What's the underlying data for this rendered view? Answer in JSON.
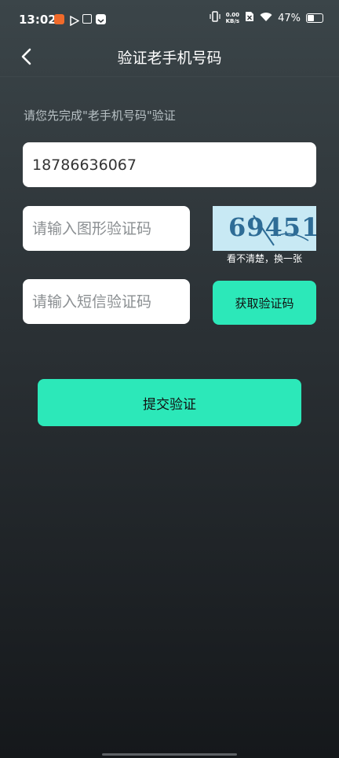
{
  "status_bar": {
    "time": "13:02",
    "net_speed_value": "0.00",
    "net_speed_unit": "KB/s",
    "battery": "47%"
  },
  "header": {
    "title": "验证老手机号码"
  },
  "form": {
    "hint": "请您先完成\"老手机号码\"验证",
    "phone_value": "18786636067",
    "captcha_placeholder": "请输入图形验证码",
    "captcha_image_text": "69451",
    "captcha_refresh_label": "看不清楚，换一张",
    "sms_placeholder": "请输入短信验证码",
    "sms_button_label": "获取验证码",
    "submit_label": "提交验证"
  },
  "colors": {
    "accent": "#2ce8b9",
    "background_top": "#3b4549",
    "background_bottom": "#15181b"
  }
}
